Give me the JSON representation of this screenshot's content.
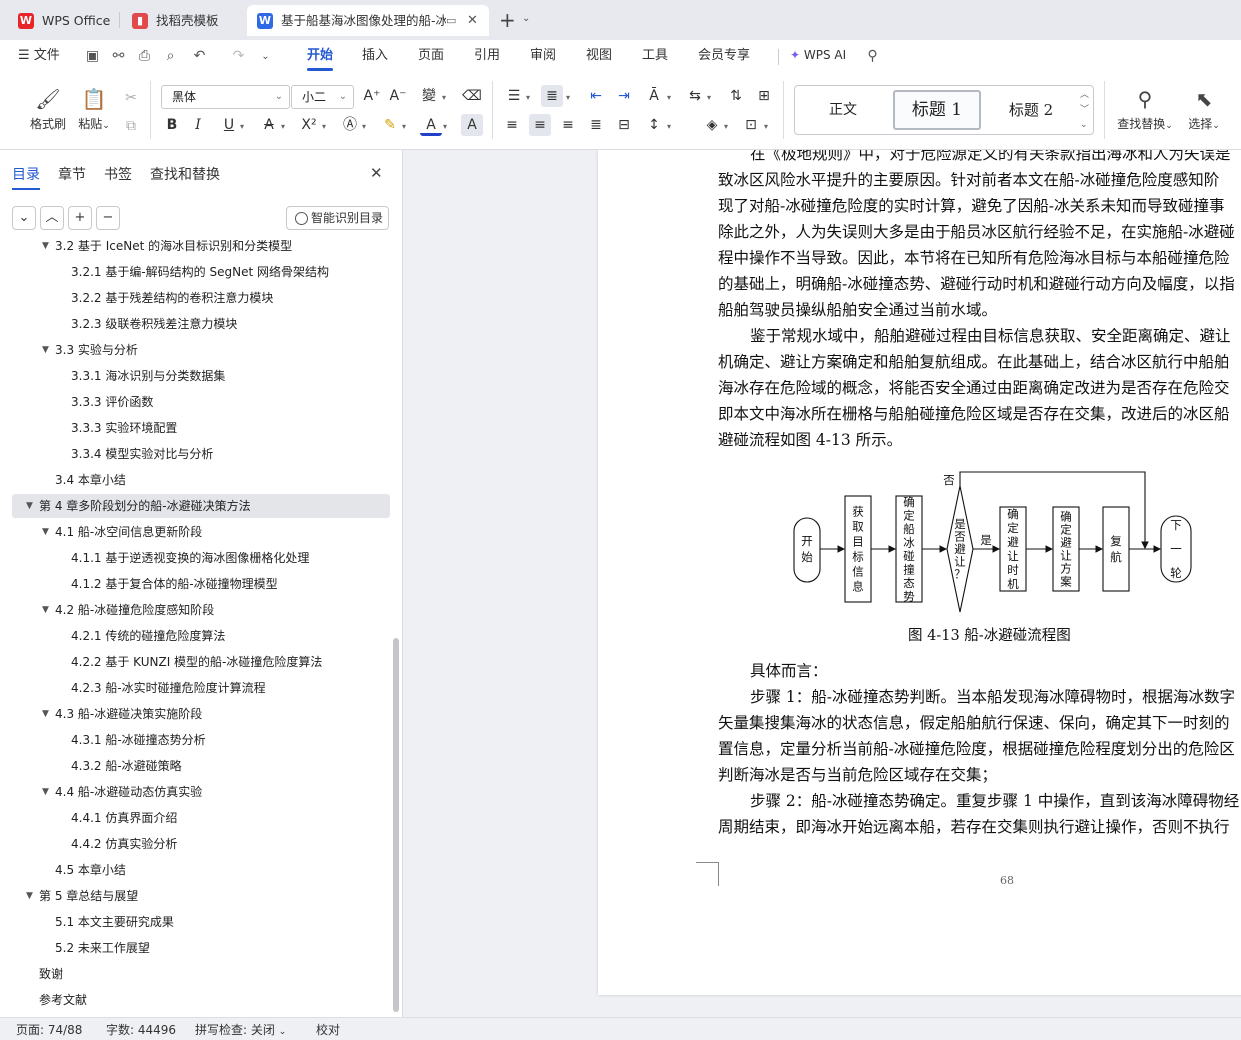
{
  "tabs": [
    {
      "label": "WPS Office",
      "icon": "wps-logo-icon"
    },
    {
      "label": "找稻壳模板",
      "icon": "docer-icon"
    },
    {
      "label": "基于船基海冰图像处理的船-冰",
      "icon": "wps-writer-icon"
    }
  ],
  "menubar": {
    "file": "文件",
    "items": [
      "开始",
      "插入",
      "页面",
      "引用",
      "审阅",
      "视图",
      "工具",
      "会员专享"
    ],
    "ai": "WPS AI"
  },
  "ribbon": {
    "format_painter": "格式刷",
    "paste": "粘贴",
    "font_name": "黑体",
    "font_size": "小二",
    "styles": {
      "normal": "正文",
      "h1": "标题",
      "h1_num": "1",
      "h2": "标题",
      "h2_num": "2"
    },
    "find_replace": "查找替换",
    "select": "选择"
  },
  "sidebar": {
    "tabs": [
      "目录",
      "章节",
      "书签",
      "查找和替换"
    ],
    "smart_toc": "智能识别目录",
    "toc": [
      {
        "level": 2,
        "text": "3.2  基于 IceNet 的海冰目标识别和分类模型",
        "expanded": true
      },
      {
        "level": 3,
        "text": "3.2.1  基于编-解码结构的 SegNet 网络骨架结构"
      },
      {
        "level": 3,
        "text": "3.2.2  基于残差结构的卷积注意力模块"
      },
      {
        "level": 3,
        "text": "3.2.3  级联卷积残差注意力模块"
      },
      {
        "level": 2,
        "text": "3.3  实验与分析",
        "expanded": true
      },
      {
        "level": 3,
        "text": "3.3.1  海冰识别与分类数据集"
      },
      {
        "level": 3,
        "text": "3.3.3  评价函数"
      },
      {
        "level": 3,
        "text": "3.3.3  实验环境配置"
      },
      {
        "level": 3,
        "text": "3.3.4  模型实验对比与分析"
      },
      {
        "level": 2,
        "text": "3.4  本章小结"
      },
      {
        "level": 1,
        "text": "第 4 章多阶段划分的船-冰避碰决策方法",
        "expanded": true,
        "active": true
      },
      {
        "level": 2,
        "text": "4.1  船-冰空间信息更新阶段",
        "expanded": true
      },
      {
        "level": 3,
        "text": "4.1.1  基于逆透视变换的海冰图像栅格化处理"
      },
      {
        "level": 3,
        "text": "4.1.2  基于复合体的船-冰碰撞物理模型"
      },
      {
        "level": 2,
        "text": "4.2  船-冰碰撞危险度感知阶段",
        "expanded": true
      },
      {
        "level": 3,
        "text": "4.2.1  传统的碰撞危险度算法"
      },
      {
        "level": 3,
        "text": "4.2.2  基于 KUNZI 模型的船-冰碰撞危险度算法"
      },
      {
        "level": 3,
        "text": "4.2.3  船-冰实时碰撞危险度计算流程"
      },
      {
        "level": 2,
        "text": "4.3  船-冰避碰决策实施阶段",
        "expanded": true
      },
      {
        "level": 3,
        "text": "4.3.1  船-冰碰撞态势分析"
      },
      {
        "level": 3,
        "text": "4.3.2  船-冰避碰策略"
      },
      {
        "level": 2,
        "text": "4.4  船-冰避碰动态仿真实验",
        "expanded": true
      },
      {
        "level": 3,
        "text": "4.4.1  仿真界面介绍"
      },
      {
        "level": 3,
        "text": "4.4.2  仿真实验分析"
      },
      {
        "level": 2,
        "text": "4.5  本章小结"
      },
      {
        "level": 1,
        "text": "第 5 章总结与展望",
        "expanded": true
      },
      {
        "level": 2,
        "text": "5.1  本文主要研究成果"
      },
      {
        "level": 2,
        "text": "5.2  未来工作展望"
      },
      {
        "level": 1,
        "text": "致谢"
      },
      {
        "level": 1,
        "text": "参考文献"
      }
    ]
  },
  "document": {
    "lines": [
      {
        "indent": true,
        "text": "在《极地规则》中，对于危险源定义的有关条款指出海冰和人为失误是"
      },
      {
        "text": "致冰区风险水平提升的主要原因。针对前者本文在船-冰碰撞危险度感知阶"
      },
      {
        "text": "现了对船-冰碰撞危险度的实时计算，避免了因船-冰关系未知而导致碰撞事"
      },
      {
        "text": "除此之外，人为失误则大多是由于船员冰区航行经验不足，在实施船-冰避碰"
      },
      {
        "text": "程中操作不当导致。因此，本节将在已知所有危险海冰目标与本船碰撞危险"
      },
      {
        "text": "的基础上，明确船-冰碰撞态势、避碰行动时机和避碰行动方向及幅度，以指"
      },
      {
        "text": "船舶驾驶员操纵船舶安全通过当前水域。"
      },
      {
        "indent": true,
        "text": "鉴于常规水域中，船舶避碰过程由目标信息获取、安全距离确定、避让"
      },
      {
        "text": "机确定、避让方案确定和船舶复航组成。在此基础上，结合冰区航行中船舶"
      },
      {
        "text": "海冰存在危险域的概念，将能否安全通过由距离确定改进为是否存在危险交"
      },
      {
        "text": "即本文中海冰所在栅格与船舶碰撞危险区域是否存在交集，改进后的冰区船"
      },
      {
        "text": "避碰流程如图 4-13 所示。"
      }
    ],
    "lines2": [
      {
        "indent": true,
        "text": "具体而言："
      },
      {
        "indent": true,
        "text": "步骤 1：船-冰碰撞态势判断。当本船发现海冰障碍物时，根据海冰数字"
      },
      {
        "text": "矢量集搜集海冰的状态信息，假定船舶航行保速、保向，确定其下一时刻的"
      },
      {
        "text": "置信息，定量分析当前船-冰碰撞危险度，根据碰撞危险程度划分出的危险区"
      },
      {
        "text": "判断海冰是否与当前危险区域存在交集；"
      },
      {
        "indent": true,
        "text": "步骤 2：船-冰碰撞态势确定。重复步骤 1 中操作，直到该海冰障碍物经"
      },
      {
        "text": "周期结束，即海冰开始远离本船，若存在交集则执行避让操作，否则不执行"
      }
    ],
    "figure": {
      "start": "开始",
      "acquire": "获取目标信息",
      "determine_situation": "确定船冰碰撞态势",
      "decision": "是否避让？",
      "yes": "是",
      "no": "否",
      "timing": "确定避让时机",
      "plan": "确定避让方案",
      "resume": "复航",
      "next": "下一轮"
    },
    "caption": "图 4-13  船-冰避碰流程图",
    "page_number": "68"
  },
  "statusbar": {
    "page": "页面: 74/88",
    "words": "字数: 44496",
    "spell": "拼写检查: 关闭",
    "proof": "校对"
  }
}
